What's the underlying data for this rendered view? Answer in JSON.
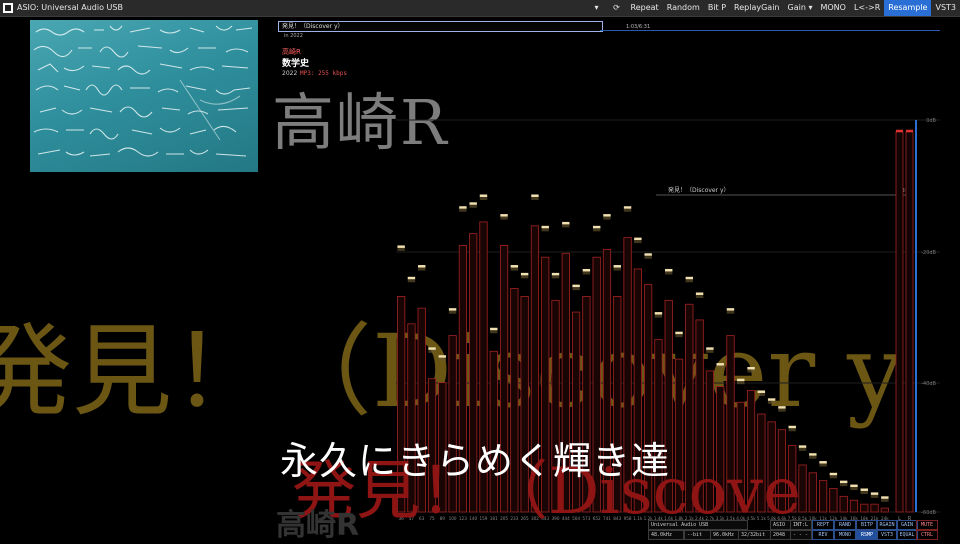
{
  "titlebar": {
    "device": "ASIO: Universal Audio USB",
    "buttons": [
      "Repeat",
      "Random",
      "Bit P",
      "ReplayGain",
      "Gain ▾",
      "MONO",
      "L<->R",
      "Resample",
      "VST3"
    ],
    "active_button": "Resample"
  },
  "track": {
    "title_box": "発見！（Discover y）",
    "year_small": "in 2022",
    "time": "1:03/6:31",
    "artist": "高崎R",
    "album": "数学史",
    "year": "2022",
    "codec": "MP3: 255 kbps"
  },
  "background_text": {
    "artist": "高崎R",
    "title": "発見！（Discover y",
    "title2": "発見！（Discove",
    "artist2": "高崎R"
  },
  "lyric": "永久にきらめく輝き達",
  "analyzer": {
    "db_labels": [
      "0dB",
      "-20dB",
      "-40dB",
      "-60dB"
    ],
    "marker_label": "発見！（Discover y）",
    "marker_time": "6:31",
    "freq_labels": [
      "36",
      "57",
      "63",
      "75",
      "89",
      "100",
      "123",
      "140",
      "159",
      "181",
      "205",
      "233",
      "265",
      "302",
      "343",
      "390",
      "444",
      "504",
      "573",
      "652",
      "741",
      "843",
      "958",
      "1.1k",
      "1.2k",
      "1.4k",
      "1.6k",
      "1.8k",
      "2.1k",
      "2.4k",
      "2.7k",
      "3.1k",
      "3.5k",
      "4.0k",
      "4.5k",
      "5.1k",
      "5.8k",
      "6.6k",
      "7.5k",
      "8.5k",
      "10k",
      "11k",
      "12k",
      "14k",
      "16k",
      "18k",
      "21k",
      "24k"
    ],
    "bars": [
      0.55,
      0.48,
      0.52,
      0.34,
      0.33,
      0.45,
      0.68,
      0.71,
      0.74,
      0.41,
      0.68,
      0.57,
      0.55,
      0.73,
      0.65,
      0.54,
      0.66,
      0.51,
      0.55,
      0.65,
      0.67,
      0.55,
      0.7,
      0.62,
      0.58,
      0.44,
      0.54,
      0.39,
      0.53,
      0.49,
      0.36,
      0.32,
      0.45,
      0.28,
      0.31,
      0.25,
      0.23,
      0.21,
      0.17,
      0.12,
      0.1,
      0.08,
      0.06,
      0.04,
      0.03,
      0.02,
      0.02,
      0.01
    ],
    "peaks": [
      0.68,
      0.6,
      0.63,
      0.42,
      0.4,
      0.52,
      0.78,
      0.79,
      0.81,
      0.47,
      0.76,
      0.63,
      0.61,
      0.81,
      0.73,
      0.61,
      0.74,
      0.58,
      0.62,
      0.73,
      0.76,
      0.63,
      0.78,
      0.7,
      0.66,
      0.51,
      0.62,
      0.46,
      0.6,
      0.56,
      0.42,
      0.38,
      0.52,
      0.34,
      0.37,
      0.31,
      0.29,
      0.27,
      0.22,
      0.17,
      0.15,
      0.13,
      0.1,
      0.08,
      0.07,
      0.06,
      0.05,
      0.04
    ],
    "channel_levels": {
      "L": 0.97,
      "R": 0.97
    },
    "channel_labels": [
      "L",
      "R"
    ]
  },
  "status": {
    "device": "Universal Audio USB",
    "samplerate": "48.0kHz",
    "bit": "--bit",
    "out_rate": "96.0kHz",
    "out_bit": "32/32bit",
    "buffer": "2048",
    "dash": "- - - -",
    "mode": "ASIO",
    "int": "INT:L",
    "btns_row1": [
      "REPT",
      "RAND",
      "BITP",
      "RGAIN",
      "GAIN",
      "LR/RL",
      "MUTE"
    ],
    "btns_row2": [
      "REV",
      "MONO",
      "RSMP",
      "VST3",
      "EQUAL",
      "CTRL"
    ]
  },
  "colors": {
    "accent": "#2a6fd6",
    "bar": "#8f1a1a",
    "peak": "#f1e0b0"
  }
}
